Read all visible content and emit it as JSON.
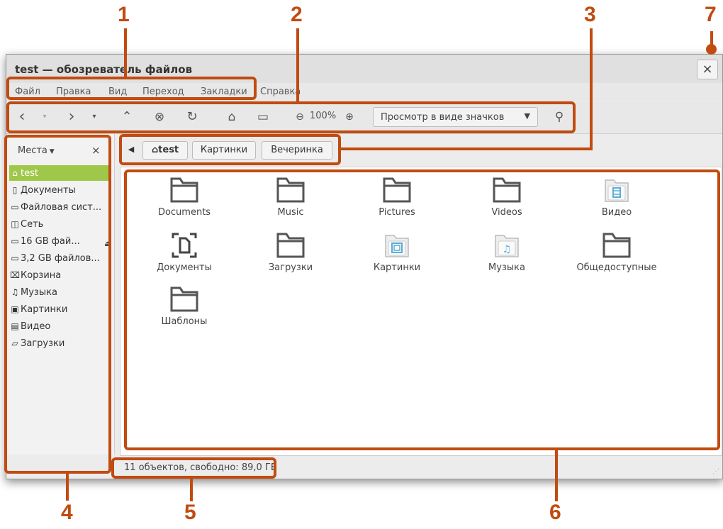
{
  "window": {
    "title": "test — обозреватель файлов",
    "close_glyph": "×"
  },
  "menu": [
    "Файл",
    "Правка",
    "Вид",
    "Переход",
    "Закладки",
    "Справка"
  ],
  "toolbar": {
    "icons": [
      "back-icon",
      "back-history-icon",
      "forward-icon",
      "forward-history-icon",
      "up-icon",
      "stop-icon",
      "reload-icon",
      "home-icon",
      "computer-icon",
      "zoom-out-icon",
      "zoom-in-icon",
      "search-icon"
    ],
    "zoom": "100%",
    "view_mode": "Просмотр в виде значков"
  },
  "sidebar": {
    "header": "Места",
    "close_glyph": "×",
    "items": [
      {
        "label": "test",
        "icon": "home-icon",
        "active": true
      },
      {
        "label": "Документы",
        "icon": "document-icon"
      },
      {
        "label": "Файловая сист...",
        "icon": "drive-icon"
      },
      {
        "label": "Сеть",
        "icon": "network-icon"
      },
      {
        "label": "16 GB фай...",
        "icon": "drive-icon",
        "eject": true
      },
      {
        "label": "3,2 GB файлов...",
        "icon": "drive-icon"
      },
      {
        "label": "Корзина",
        "icon": "trash-icon"
      },
      {
        "label": "Музыка",
        "icon": "music-icon"
      },
      {
        "label": "Картинки",
        "icon": "pictures-icon"
      },
      {
        "label": "Видео",
        "icon": "video-icon"
      },
      {
        "label": "Загрузки",
        "icon": "downloads-icon"
      }
    ]
  },
  "pathbar": {
    "crumbs": [
      "test",
      "Картинки",
      "Вечеринка"
    ]
  },
  "files": [
    {
      "label": "Documents",
      "icon": "folder-icon"
    },
    {
      "label": "Music",
      "icon": "folder-icon"
    },
    {
      "label": "Pictures",
      "icon": "folder-icon"
    },
    {
      "label": "Videos",
      "icon": "folder-icon"
    },
    {
      "label": "Видео",
      "icon": "video-folder-icon"
    },
    {
      "label": "Документы",
      "icon": "documents-folder-icon"
    },
    {
      "label": "Загрузки",
      "icon": "folder-icon"
    },
    {
      "label": "Картинки",
      "icon": "pictures-folder-icon"
    },
    {
      "label": "Музыка",
      "icon": "music-folder-icon"
    },
    {
      "label": "Общедоступные",
      "icon": "folder-icon"
    },
    {
      "label": "Шаблоны",
      "icon": "folder-icon"
    }
  ],
  "status": "11 объектов, свободно: 89,0 ГБ",
  "callouts": [
    "1",
    "2",
    "3",
    "4",
    "5",
    "6",
    "7"
  ],
  "colors": {
    "callout": "#c14b10",
    "selection": "#9fc84a",
    "folder_accent": "#5aaed6"
  }
}
